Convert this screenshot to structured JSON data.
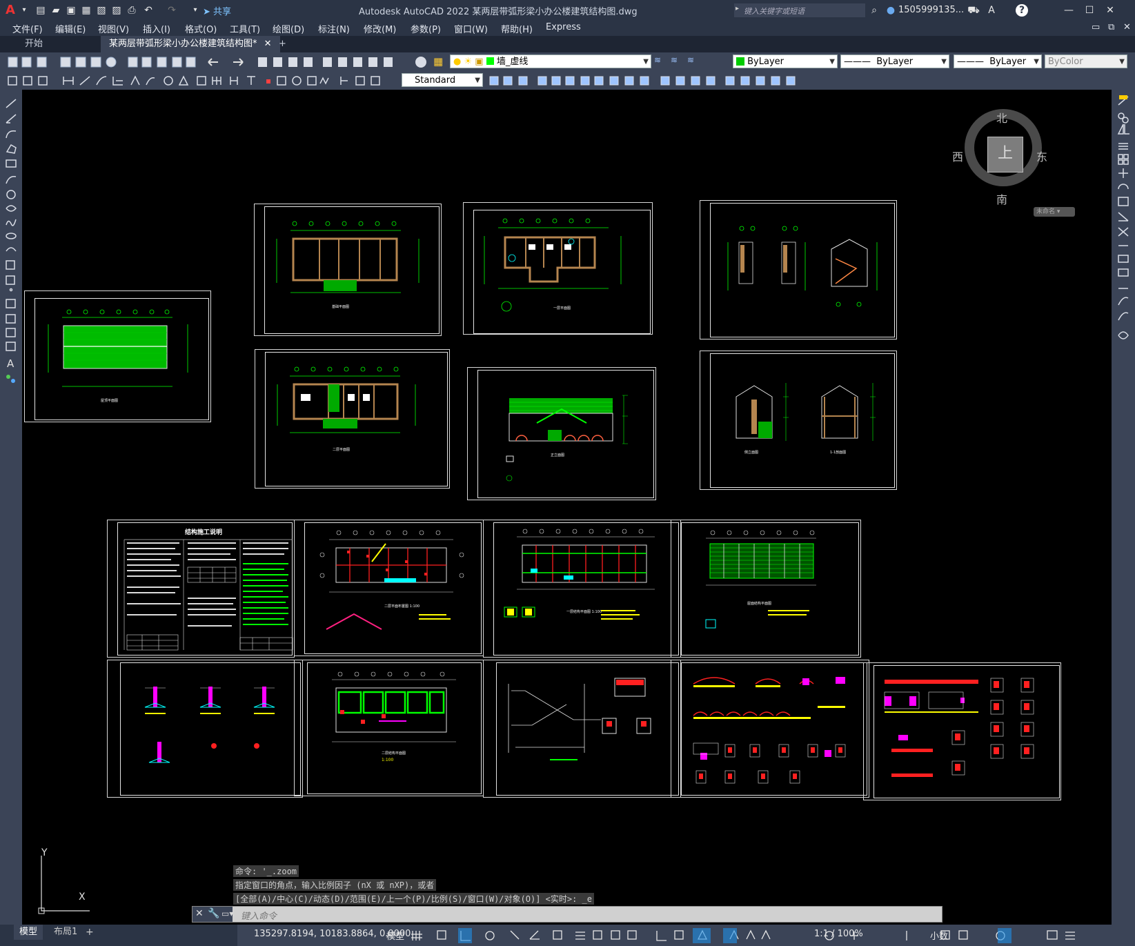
{
  "app": {
    "title": "Autodesk AutoCAD 2022    某两层带弧形梁小办公楼建筑结构图.dwg",
    "search_placeholder": "键入关键字或短语",
    "user": "1505999135...",
    "share": "共享"
  },
  "menu": [
    "文件(F)",
    "编辑(E)",
    "视图(V)",
    "插入(I)",
    "格式(O)",
    "工具(T)",
    "绘图(D)",
    "标注(N)",
    "修改(M)",
    "参数(P)",
    "窗口(W)",
    "帮助(H)",
    "Express"
  ],
  "tabs": [
    "开始",
    "某两层带弧形梁小办公楼建筑结构图*"
  ],
  "toolbar": {
    "layer": "墙_虚线",
    "color": "ByLayer",
    "linetype": "ByLayer",
    "lineweight": "ByLayer",
    "plotstyle": "ByColor",
    "textstyle": "Standard"
  },
  "viewcube": {
    "north": "北",
    "south": "南",
    "east": "东",
    "west": "西",
    "top": "上",
    "ucs": "未命名"
  },
  "command": {
    "history": [
      "命令: '_.zoom",
      "指定窗口的角点，输入比例因子 (nX 或 nXP)，或者",
      "[全部(A)/中心(C)/动态(D)/范围(E)/上一个(P)/比例(S)/窗口(W)/对象(O)] <实时>: _e"
    ],
    "placeholder": "键入命令"
  },
  "ucs": {
    "x": "X",
    "y": "Y"
  },
  "status": {
    "tabs": [
      "模型",
      "布局1"
    ],
    "coords": "135297.8194, 10183.8864, 0.0000",
    "model": "模型",
    "scale": "1:1 / 100%",
    "units": "小数"
  },
  "accent": "#1f8fe6",
  "drawing_colors": {
    "line": "#00ff00",
    "frame": "#e0e0e0",
    "wall": "#b5854f",
    "red": "#ff2020",
    "magenta": "#ff00ff",
    "yellow": "#ffff00"
  }
}
